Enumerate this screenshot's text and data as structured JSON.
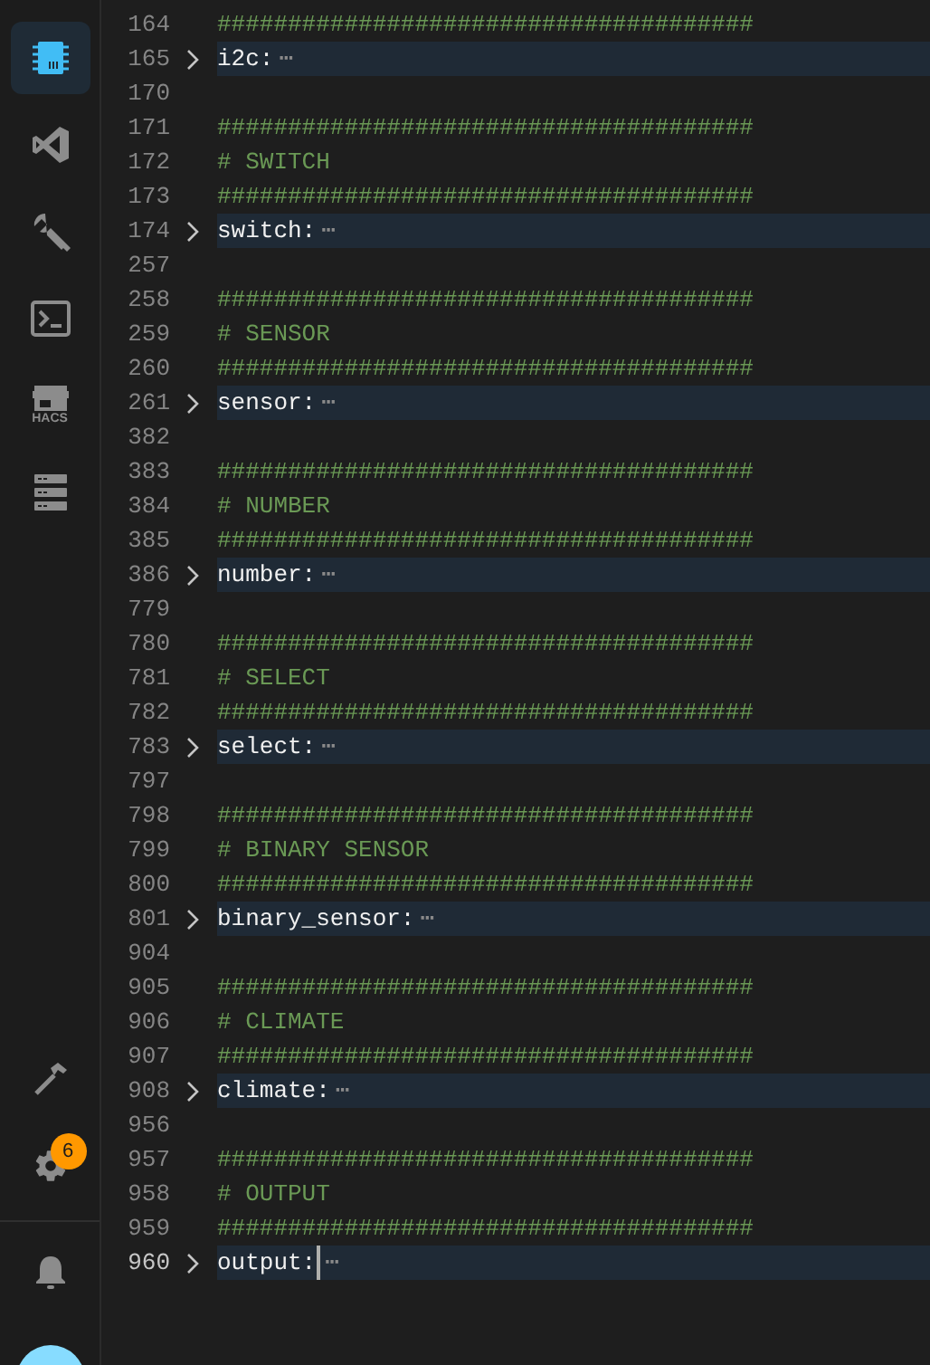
{
  "sidebar": {
    "top_items": [
      {
        "kind": "chip",
        "selected": true
      },
      {
        "kind": "vscode",
        "selected": false
      },
      {
        "kind": "wrench",
        "selected": false
      },
      {
        "kind": "terminal",
        "selected": false
      },
      {
        "kind": "store",
        "label": "HACS",
        "selected": false
      },
      {
        "kind": "server",
        "selected": false
      }
    ],
    "bottom_items": [
      {
        "kind": "hammer"
      },
      {
        "kind": "gear",
        "badge": "6"
      }
    ],
    "footer_items": [
      {
        "kind": "bell"
      },
      {
        "kind": "avatar"
      }
    ]
  },
  "editor": {
    "lines": [
      {
        "number": "164",
        "kind": "comment",
        "text": "######################################",
        "current": false
      },
      {
        "number": "165",
        "kind": "fold",
        "text": "i2c:",
        "ellipsis": "⋯",
        "current": false
      },
      {
        "number": "170",
        "kind": "blank",
        "current": false
      },
      {
        "number": "171",
        "kind": "comment",
        "text": "######################################",
        "current": false
      },
      {
        "number": "172",
        "kind": "comment",
        "text": "# SWITCH",
        "current": false
      },
      {
        "number": "173",
        "kind": "comment",
        "text": "######################################",
        "current": false
      },
      {
        "number": "174",
        "kind": "fold",
        "text": "switch:",
        "ellipsis": "⋯",
        "current": false
      },
      {
        "number": "257",
        "kind": "blank",
        "current": false
      },
      {
        "number": "258",
        "kind": "comment",
        "text": "######################################",
        "current": false
      },
      {
        "number": "259",
        "kind": "comment",
        "text": "# SENSOR",
        "current": false
      },
      {
        "number": "260",
        "kind": "comment",
        "text": "######################################",
        "current": false
      },
      {
        "number": "261",
        "kind": "fold",
        "text": "sensor:",
        "ellipsis": "⋯",
        "current": false
      },
      {
        "number": "382",
        "kind": "blank",
        "current": false
      },
      {
        "number": "383",
        "kind": "comment",
        "text": "######################################",
        "current": false
      },
      {
        "number": "384",
        "kind": "comment",
        "text": "# NUMBER",
        "current": false
      },
      {
        "number": "385",
        "kind": "comment",
        "text": "######################################",
        "current": false
      },
      {
        "number": "386",
        "kind": "fold",
        "text": "number:",
        "ellipsis": "⋯",
        "current": false
      },
      {
        "number": "779",
        "kind": "blank",
        "current": false
      },
      {
        "number": "780",
        "kind": "comment",
        "text": "######################################",
        "current": false
      },
      {
        "number": "781",
        "kind": "comment",
        "text": "# SELECT",
        "current": false
      },
      {
        "number": "782",
        "kind": "comment",
        "text": "######################################",
        "current": false
      },
      {
        "number": "783",
        "kind": "fold",
        "text": "select:",
        "ellipsis": "⋯",
        "current": false
      },
      {
        "number": "797",
        "kind": "blank",
        "current": false
      },
      {
        "number": "798",
        "kind": "comment",
        "text": "######################################",
        "current": false
      },
      {
        "number": "799",
        "kind": "comment",
        "text": "# BINARY SENSOR",
        "current": false
      },
      {
        "number": "800",
        "kind": "comment",
        "text": "######################################",
        "current": false
      },
      {
        "number": "801",
        "kind": "fold",
        "text": "binary_sensor:",
        "ellipsis": "⋯",
        "current": false
      },
      {
        "number": "904",
        "kind": "blank",
        "current": false
      },
      {
        "number": "905",
        "kind": "comment",
        "text": "######################################",
        "current": false
      },
      {
        "number": "906",
        "kind": "comment",
        "text": "# CLIMATE",
        "current": false
      },
      {
        "number": "907",
        "kind": "comment",
        "text": "######################################",
        "current": false
      },
      {
        "number": "908",
        "kind": "fold",
        "text": "climate:",
        "ellipsis": "⋯",
        "current": false
      },
      {
        "number": "956",
        "kind": "blank",
        "current": false
      },
      {
        "number": "957",
        "kind": "comment",
        "text": "######################################",
        "current": false
      },
      {
        "number": "958",
        "kind": "comment",
        "text": "# OUTPUT",
        "current": false
      },
      {
        "number": "959",
        "kind": "comment",
        "text": "######################################",
        "current": false
      },
      {
        "number": "960",
        "kind": "fold",
        "text": "output:",
        "ellipsis": "⋯",
        "current": true
      }
    ]
  }
}
